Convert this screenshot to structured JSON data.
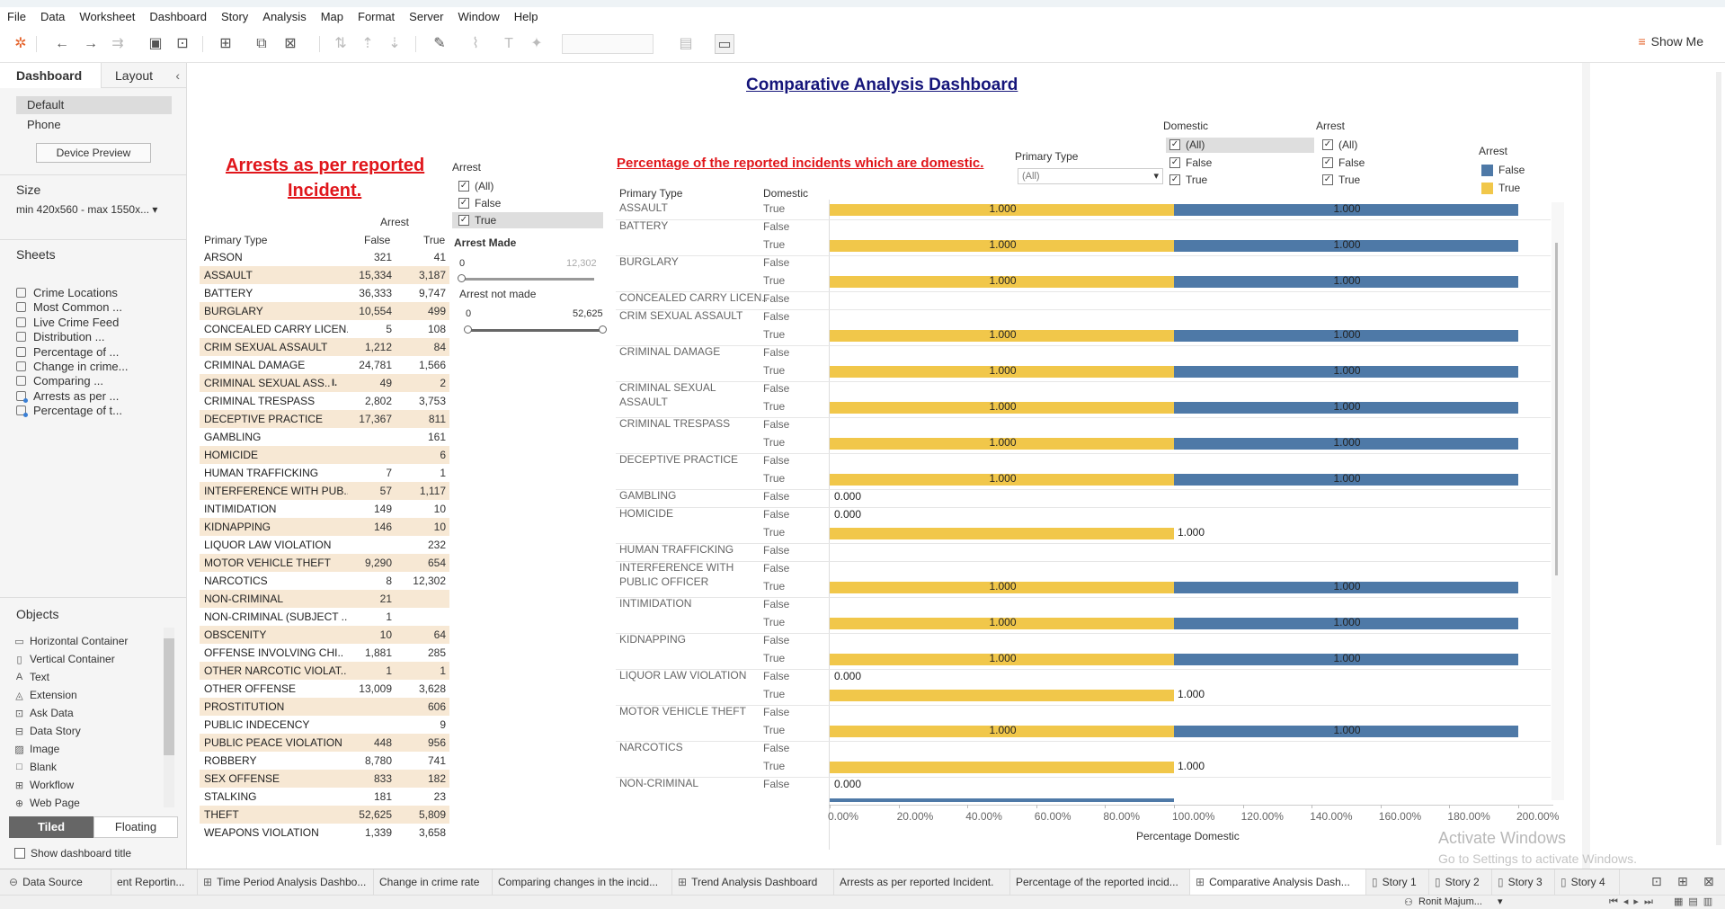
{
  "menu": [
    "File",
    "Data",
    "Worksheet",
    "Dashboard",
    "Story",
    "Analysis",
    "Map",
    "Format",
    "Server",
    "Window",
    "Help"
  ],
  "toolbar": {
    "show_me": "Show Me"
  },
  "left_pane": {
    "tabs": [
      "Dashboard",
      "Layout"
    ],
    "device_options": [
      "Default",
      "Phone"
    ],
    "device_preview": "Device Preview",
    "size_header": "Size",
    "size_value": "min 420x560 - max 1550x...",
    "sheets_header": "Sheets",
    "sheets": [
      "Crime Locations",
      "Most Common ...",
      "Live Crime Feed",
      "Distribution ...",
      "Percentage of ...",
      "Change in crime...",
      "Comparing ...",
      "Arrests as per ...",
      "Percentage of t..."
    ],
    "objects_header": "Objects",
    "objects": [
      {
        "label": "Horizontal Container",
        "icon": "horizontal-container-icon",
        "glyph": "▭"
      },
      {
        "label": "Vertical Container",
        "icon": "vertical-container-icon",
        "glyph": "▯"
      },
      {
        "label": "Text",
        "icon": "text-icon",
        "glyph": "A"
      },
      {
        "label": "Extension",
        "icon": "extension-icon",
        "glyph": "◬"
      },
      {
        "label": "Ask Data",
        "icon": "ask-data-icon",
        "glyph": "⊡"
      },
      {
        "label": "Data Story",
        "icon": "data-story-icon",
        "glyph": "⊟"
      },
      {
        "label": "Image",
        "icon": "image-icon",
        "glyph": "▨"
      },
      {
        "label": "Blank",
        "icon": "blank-icon",
        "glyph": "□"
      },
      {
        "label": "Workflow",
        "icon": "workflow-icon",
        "glyph": "⊞"
      },
      {
        "label": "Web Page",
        "icon": "web-page-icon",
        "glyph": "⊕"
      }
    ],
    "tiled": "Tiled",
    "floating": "Floating",
    "show_title": "Show dashboard title"
  },
  "dashboard": {
    "title": "Comparative Analysis Dashboard",
    "arrests_title_1": "Arrests as per reported",
    "arrests_title_2": "Incident.",
    "arrests_table": {
      "group_header": "Arrest",
      "col_primary": "Primary Type",
      "col_false": "False",
      "col_true": "True",
      "rows": [
        [
          "ARSON",
          "321",
          "41"
        ],
        [
          "ASSAULT",
          "15,334",
          "3,187"
        ],
        [
          "BATTERY",
          "36,333",
          "9,747"
        ],
        [
          "BURGLARY",
          "10,554",
          "499"
        ],
        [
          "CONCEALED CARRY LICEN..",
          "5",
          "108"
        ],
        [
          "CRIM SEXUAL ASSAULT",
          "1,212",
          "84"
        ],
        [
          "CRIMINAL DAMAGE",
          "24,781",
          "1,566"
        ],
        [
          "CRIMINAL SEXUAL ASS..",
          "49",
          "2"
        ],
        [
          "CRIMINAL TRESPASS",
          "2,802",
          "3,753"
        ],
        [
          "DECEPTIVE PRACTICE",
          "17,367",
          "811"
        ],
        [
          "GAMBLING",
          "",
          "161"
        ],
        [
          "HOMICIDE",
          "",
          "6"
        ],
        [
          "HUMAN TRAFFICKING",
          "7",
          "1"
        ],
        [
          "INTERFERENCE WITH PUB..",
          "57",
          "1,117"
        ],
        [
          "INTIMIDATION",
          "149",
          "10"
        ],
        [
          "KIDNAPPING",
          "146",
          "10"
        ],
        [
          "LIQUOR LAW VIOLATION",
          "",
          "232"
        ],
        [
          "MOTOR VEHICLE THEFT",
          "9,290",
          "654"
        ],
        [
          "NARCOTICS",
          "8",
          "12,302"
        ],
        [
          "NON-CRIMINAL",
          "21",
          ""
        ],
        [
          "NON-CRIMINAL (SUBJECT ..",
          "1",
          ""
        ],
        [
          "OBSCENITY",
          "10",
          "64"
        ],
        [
          "OFFENSE INVOLVING CHI..",
          "1,881",
          "285"
        ],
        [
          "OTHER NARCOTIC VIOLAT..",
          "1",
          "1"
        ],
        [
          "OTHER OFFENSE",
          "13,009",
          "3,628"
        ],
        [
          "PROSTITUTION",
          "",
          "606"
        ],
        [
          "PUBLIC INDECENCY",
          "",
          "9"
        ],
        [
          "PUBLIC PEACE VIOLATION",
          "448",
          "956"
        ],
        [
          "ROBBERY",
          "8,780",
          "741"
        ],
        [
          "SEX OFFENSE",
          "833",
          "182"
        ],
        [
          "STALKING",
          "181",
          "23"
        ],
        [
          "THEFT",
          "52,625",
          "5,809"
        ],
        [
          "WEAPONS VIOLATION",
          "1,339",
          "3,658"
        ]
      ]
    },
    "arrest_filter": {
      "title": "Arrest",
      "items": [
        "(All)",
        "False",
        "True"
      ]
    },
    "arrest_made": {
      "title": "Arrest Made",
      "min": "0",
      "max": "12,302"
    },
    "arrest_not_made": {
      "title": "Arrest not made",
      "min": "0",
      "max": "52,625"
    },
    "pct_title": "Percentage of the reported incidents which are domestic.",
    "primary_type_filter": {
      "title": "Primary Type",
      "value": "(All)"
    },
    "domestic_filter": {
      "title": "Domestic",
      "items": [
        "(All)",
        "False",
        "True"
      ]
    },
    "arrest_filter2": {
      "title": "Arrest",
      "items": [
        "(All)",
        "False",
        "True"
      ]
    },
    "legend": {
      "title": "Arrest",
      "items": [
        {
          "label": "False",
          "color": "#4e79a7"
        },
        {
          "label": "True",
          "color": "#f1c74a"
        }
      ]
    },
    "chart_col_primary": "Primary Type",
    "chart_col_domestic": "Domestic",
    "x_axis_title": "Percentage Domestic"
  },
  "chart_data": {
    "type": "bar",
    "orientation": "horizontal",
    "stacked": true,
    "xlabel": "Percentage Domestic",
    "x_ticks": [
      "0.00%",
      "20.00%",
      "40.00%",
      "60.00%",
      "80.00%",
      "100.00%",
      "120.00%",
      "140.00%",
      "160.00%",
      "180.00%",
      "200.00%"
    ],
    "xlim": [
      0,
      2.0
    ],
    "colors": {
      "True": "#f1c74a",
      "False": "#4e79a7"
    },
    "groups": [
      {
        "type": [
          "ASSAULT"
        ],
        "rows": [
          {
            "dom": "True",
            "t": 1.0,
            "f": 1.0
          }
        ]
      },
      {
        "type": [
          "BATTERY"
        ],
        "rows": [
          {
            "dom": "False"
          },
          {
            "dom": "True",
            "t": 1.0,
            "f": 1.0
          }
        ]
      },
      {
        "type": [
          "BURGLARY"
        ],
        "rows": [
          {
            "dom": "False"
          },
          {
            "dom": "True",
            "t": 1.0,
            "f": 1.0
          }
        ]
      },
      {
        "type": [
          "CONCEALED CARRY LICEN.."
        ],
        "rows": [
          {
            "dom": "False"
          }
        ]
      },
      {
        "type": [
          "CRIM SEXUAL ASSAULT"
        ],
        "rows": [
          {
            "dom": "False"
          },
          {
            "dom": "True",
            "t": 1.0,
            "f": 1.0
          }
        ]
      },
      {
        "type": [
          "CRIMINAL DAMAGE"
        ],
        "rows": [
          {
            "dom": "False"
          },
          {
            "dom": "True",
            "t": 1.0,
            "f": 1.0
          }
        ]
      },
      {
        "type": [
          "CRIMINAL SEXUAL",
          "ASSAULT"
        ],
        "rows": [
          {
            "dom": "False"
          },
          {
            "dom": "True",
            "t": 1.0,
            "f": 1.0
          }
        ]
      },
      {
        "type": [
          "CRIMINAL TRESPASS"
        ],
        "rows": [
          {
            "dom": "False"
          },
          {
            "dom": "True",
            "t": 1.0,
            "f": 1.0
          }
        ]
      },
      {
        "type": [
          "DECEPTIVE PRACTICE"
        ],
        "rows": [
          {
            "dom": "False"
          },
          {
            "dom": "True",
            "t": 1.0,
            "f": 1.0
          }
        ]
      },
      {
        "type": [
          "GAMBLING"
        ],
        "rows": [
          {
            "dom": "False",
            "zero": "0.000"
          }
        ]
      },
      {
        "type": [
          "HOMICIDE"
        ],
        "rows": [
          {
            "dom": "False",
            "zero": "0.000"
          },
          {
            "dom": "True",
            "t": 1.0
          }
        ]
      },
      {
        "type": [
          "HUMAN TRAFFICKING"
        ],
        "rows": [
          {
            "dom": "False"
          }
        ]
      },
      {
        "type": [
          "INTERFERENCE WITH",
          "PUBLIC OFFICER"
        ],
        "rows": [
          {
            "dom": "False"
          },
          {
            "dom": "True",
            "t": 1.0,
            "f": 1.0
          }
        ]
      },
      {
        "type": [
          "INTIMIDATION"
        ],
        "rows": [
          {
            "dom": "False"
          },
          {
            "dom": "True",
            "t": 1.0,
            "f": 1.0
          }
        ]
      },
      {
        "type": [
          "KIDNAPPING"
        ],
        "rows": [
          {
            "dom": "False"
          },
          {
            "dom": "True",
            "t": 1.0,
            "f": 1.0
          }
        ]
      },
      {
        "type": [
          "LIQUOR LAW VIOLATION"
        ],
        "rows": [
          {
            "dom": "False",
            "zero": "0.000"
          },
          {
            "dom": "True",
            "t": 1.0
          }
        ]
      },
      {
        "type": [
          "MOTOR VEHICLE THEFT"
        ],
        "rows": [
          {
            "dom": "False"
          },
          {
            "dom": "True",
            "t": 1.0,
            "f": 1.0
          }
        ]
      },
      {
        "type": [
          "NARCOTICS"
        ],
        "rows": [
          {
            "dom": "False"
          },
          {
            "dom": "True",
            "t": 1.0
          }
        ]
      },
      {
        "type": [
          "NON-CRIMINAL"
        ],
        "rows": [
          {
            "dom": "False",
            "zero": "0.000"
          }
        ]
      }
    ]
  },
  "bottom_tabs": [
    {
      "label": "Data Source",
      "icon": "data-source-icon",
      "glyph": "⊖"
    },
    {
      "label": "ent Reportin...",
      "glyph": ""
    },
    {
      "label": "Time Period Analysis Dashbo...",
      "icon": "dashboard-icon",
      "glyph": "⊞"
    },
    {
      "label": "Change in crime rate",
      "glyph": ""
    },
    {
      "label": "Comparing changes in the incid...",
      "glyph": ""
    },
    {
      "label": "Trend Analysis Dashboard",
      "icon": "dashboard-icon",
      "glyph": "⊞"
    },
    {
      "label": "Arrests as per reported Incident.",
      "glyph": ""
    },
    {
      "label": "Percentage of the reported incid...",
      "glyph": ""
    },
    {
      "label": "Comparative Analysis Dash...",
      "icon": "dashboard-icon",
      "glyph": "⊞",
      "active": true
    },
    {
      "label": "Story 1",
      "icon": "story-icon",
      "glyph": "▯"
    },
    {
      "label": "Story 2",
      "icon": "story-icon",
      "glyph": "▯"
    },
    {
      "label": "Story 3",
      "icon": "story-icon",
      "glyph": "▯"
    },
    {
      "label": "Story 4",
      "icon": "story-icon",
      "glyph": "▯"
    }
  ],
  "status": {
    "user": "Ronit Majum..."
  },
  "watermark": {
    "line1": "Activate Windows",
    "line2": "Go to Settings to activate Windows."
  }
}
